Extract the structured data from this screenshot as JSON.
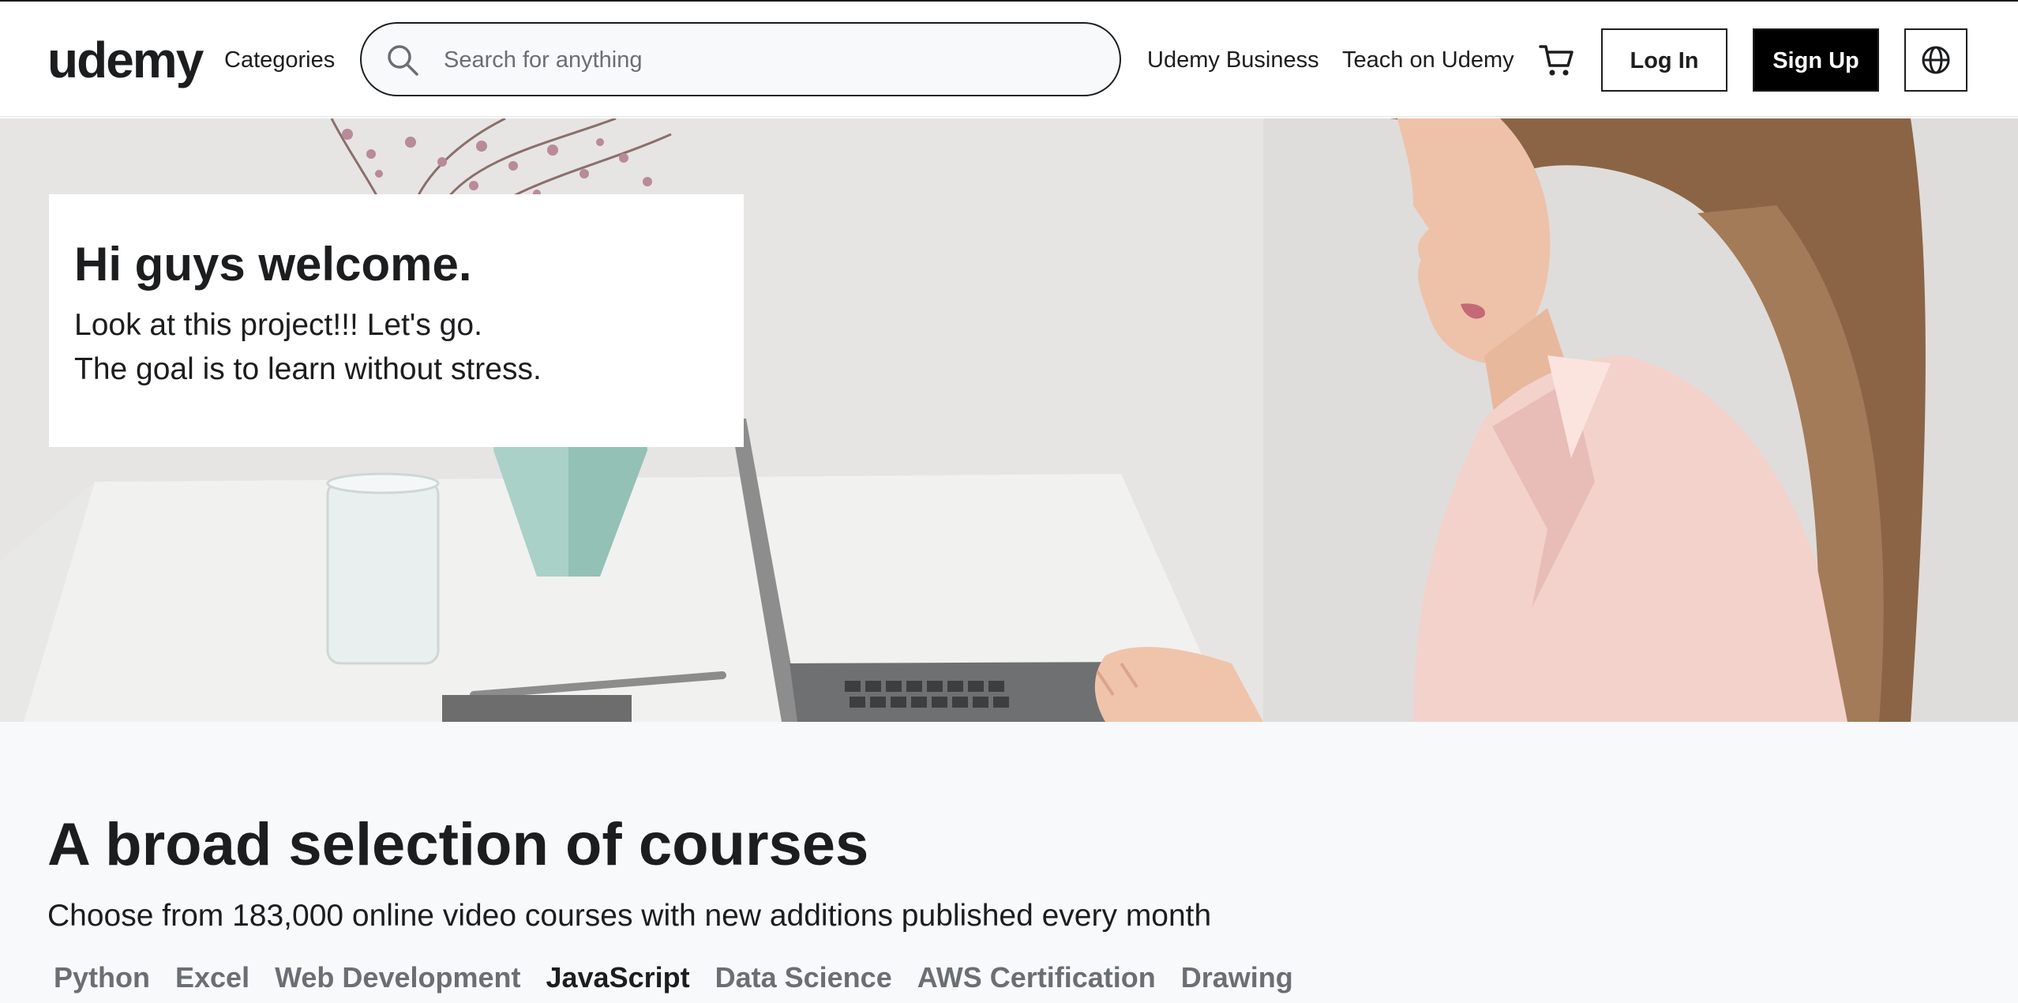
{
  "header": {
    "logo": "udemy",
    "categories_label": "Categories",
    "search_placeholder": "Search for anything",
    "business_label": "Udemy Business",
    "teach_label": "Teach on Udemy",
    "cart_icon": "cart-icon",
    "login_label": "Log In",
    "signup_label": "Sign Up",
    "language_icon": "globe-icon"
  },
  "hero": {
    "title": "Hi guys welcome.",
    "line1": "Look at this project!!! Let's go.",
    "line2": "The goal is to learn without stress."
  },
  "courses": {
    "title": "A broad selection of courses",
    "subtitle": "Choose from 183,000 online video courses with new additions published every month",
    "tabs": [
      "Python",
      "Excel",
      "Web Development",
      "JavaScript",
      "Data Science",
      "AWS Certification",
      "Drawing"
    ],
    "active_tab": "JavaScript"
  },
  "colors": {
    "text": "#1c1d1f",
    "muted": "#6a6f73",
    "page_bg": "#f7f9fa",
    "signup_bg": "#000000"
  }
}
